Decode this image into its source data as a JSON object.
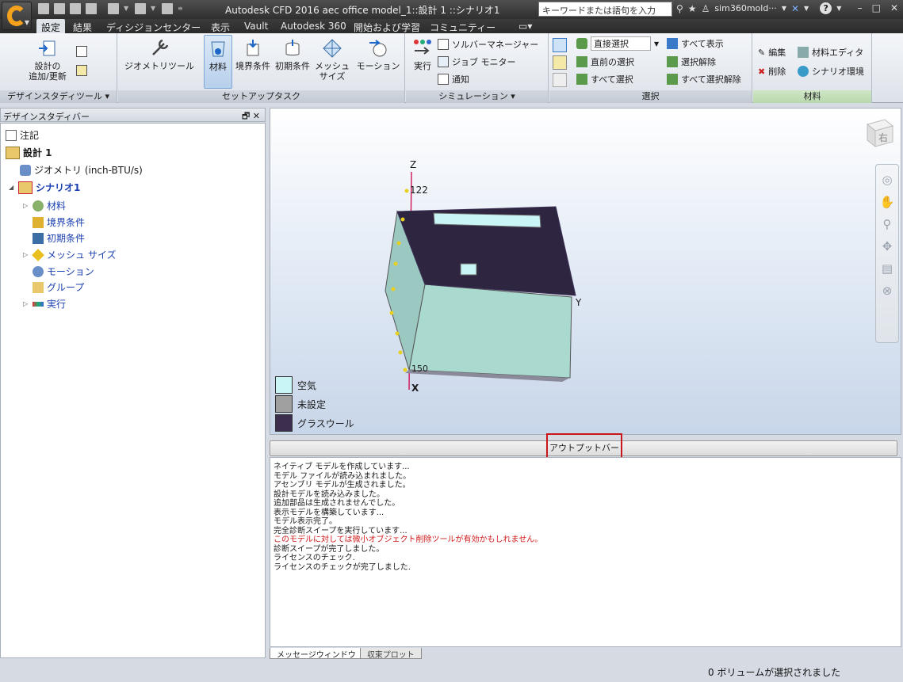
{
  "titlebar": {
    "title": "Autodesk CFD 2016   aec office model_1::設計 1 ::シナリオ1",
    "search_placeholder": "キーワードまたは語句を入力",
    "user": "sim360mold···",
    "help": "?"
  },
  "tabs": [
    "設定",
    "結果",
    "ディシジョンセンター",
    "表示",
    "Vault",
    "Autodesk 360",
    "開始および学習",
    "コミュニティー"
  ],
  "ribbon": {
    "design_panel": {
      "add_update": "設計の\n追加/更新",
      "title": "デザインスタディツール"
    },
    "setup_panel": {
      "geometry_tools": "ジオメトリツール",
      "materials": "材料",
      "boundary_conditions": "境界条件",
      "initial_conditions": "初期条件",
      "mesh_size": "メッシュ\nサイズ",
      "motion": "モーション",
      "title": "セットアップタスク"
    },
    "simulation_panel": {
      "run": "実行",
      "solver_manager": "ソルバーマネージャー",
      "job_monitor": "ジョブ モニター",
      "notify": "通知",
      "title": "シミュレーション"
    },
    "select_panel": {
      "direct_select": "直接選択",
      "previous_select": "直前の選択",
      "select_all": "すべて選択",
      "show_all": "すべて表示",
      "deselect": "選択解除",
      "deselect_all": "すべて選択解除",
      "title": "選択"
    },
    "materials_panel": {
      "edit": "編集",
      "delete": "削除",
      "material_editor": "材料エディタ",
      "scenario_env": "シナリオ環境",
      "title": "材料"
    }
  },
  "studybar": {
    "title": "デザインスタディバー",
    "notes": "注記",
    "design": "設計 1",
    "geometry": "ジオメトリ (inch-BTU/s)",
    "scenario": "シナリオ1",
    "materials": "材料",
    "boundary": "境界条件",
    "initial": "初期条件",
    "mesh": "メッシュ サイズ",
    "motion": "モーション",
    "groups": "グループ",
    "run": "実行"
  },
  "viewport": {
    "axis_z": "Z",
    "axis_y": "Y",
    "axis_x": "X",
    "tick_top": "122",
    "tick_bottom": "150",
    "viewcube_label": "右",
    "legend": [
      {
        "label": "空気",
        "color": "#c9f5f7"
      },
      {
        "label": "未設定",
        "color": "#a0a0a0"
      },
      {
        "label": "グラスウール",
        "color": "#3b2f4d"
      }
    ]
  },
  "output": {
    "bar_label": "アウトプットバー",
    "messages": [
      {
        "text": "ネイティブ モデルを作成しています...",
        "warn": false
      },
      {
        "text": "モデル ファイルが読み込まれました。",
        "warn": false
      },
      {
        "text": "アセンブリ モデルが生成されました。",
        "warn": false
      },
      {
        "text": "設計モデルを読み込みました。",
        "warn": false
      },
      {
        "text": "追加部品は生成されませんでした。",
        "warn": false
      },
      {
        "text": "表示モデルを構築しています...",
        "warn": false
      },
      {
        "text": "モデル表示完了。",
        "warn": false
      },
      {
        "text": "完全診断スイープを実行しています...",
        "warn": false
      },
      {
        "text": "このモデルに対しては微小オブジェクト削除ツールが有効かもしれません。",
        "warn": true
      },
      {
        "text": "診断スイープが完了しました。",
        "warn": false
      },
      {
        "text": "ライセンスのチェック.",
        "warn": false
      },
      {
        "text": "ライセンスのチェックが完了しました.",
        "warn": false
      }
    ],
    "tab_messages": "メッセージウィンドウ",
    "tab_convergence": "収束プロット"
  },
  "status": "0 ボリュームが選択されました",
  "colors": {
    "accent": "#c8161a",
    "tree_blue": "#1a3fb0",
    "box_top": "#2e2540",
    "box_side": "#a8d8cf"
  }
}
